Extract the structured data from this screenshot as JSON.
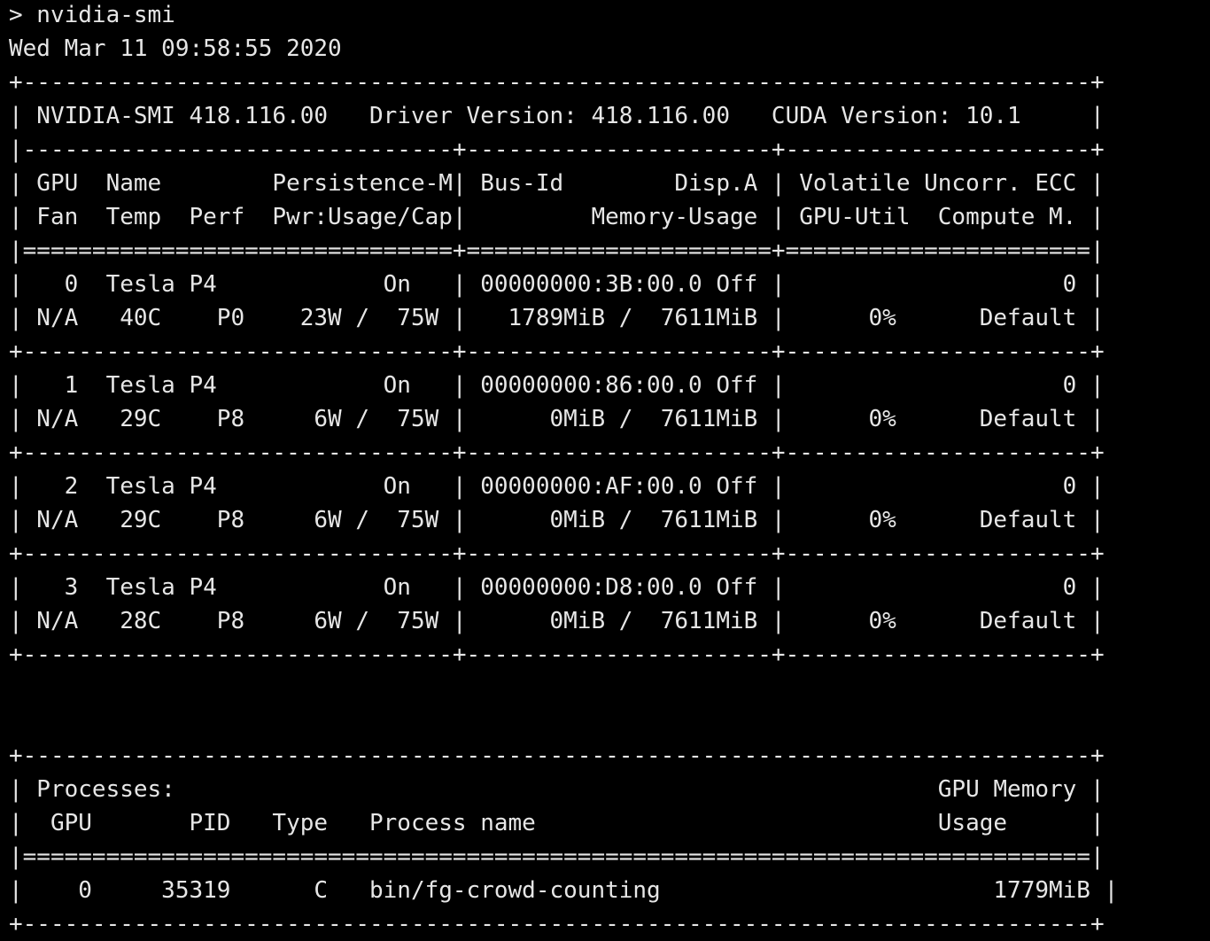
{
  "colors": {
    "background": "#000000",
    "foreground": "#e6e6e6"
  },
  "lines": [
    "> nvidia-smi",
    "Wed Mar 11 09:58:55 2020",
    "+-----------------------------------------------------------------------------+",
    "| NVIDIA-SMI 418.116.00   Driver Version: 418.116.00   CUDA Version: 10.1     |",
    "|-------------------------------+----------------------+----------------------+",
    "| GPU  Name        Persistence-M| Bus-Id        Disp.A | Volatile Uncorr. ECC |",
    "| Fan  Temp  Perf  Pwr:Usage/Cap|         Memory-Usage | GPU-Util  Compute M. |",
    "|===============================+======================+======================|",
    "|   0  Tesla P4            On   | 00000000:3B:00.0 Off |                    0 |",
    "| N/A   40C    P0    23W /  75W |   1789MiB /  7611MiB |      0%      Default |",
    "+-------------------------------+----------------------+----------------------+",
    "|   1  Tesla P4            On   | 00000000:86:00.0 Off |                    0 |",
    "| N/A   29C    P8     6W /  75W |      0MiB /  7611MiB |      0%      Default |",
    "+-------------------------------+----------------------+----------------------+",
    "|   2  Tesla P4            On   | 00000000:AF:00.0 Off |                    0 |",
    "| N/A   29C    P8     6W /  75W |      0MiB /  7611MiB |      0%      Default |",
    "+-------------------------------+----------------------+----------------------+",
    "|   3  Tesla P4            On   | 00000000:D8:00.0 Off |                    0 |",
    "| N/A   28C    P8     6W /  75W |      0MiB /  7611MiB |      0%      Default |",
    "+-------------------------------+----------------------+----------------------+",
    "",
    "",
    "+-----------------------------------------------------------------------------+",
    "| Processes:                                                       GPU Memory |",
    "|  GPU       PID   Type   Process name                             Usage      |",
    "|=============================================================================|",
    "|    0     35319      C   bin/fg-crowd-counting                        1779MiB |",
    "+-----------------------------------------------------------------------------+"
  ]
}
